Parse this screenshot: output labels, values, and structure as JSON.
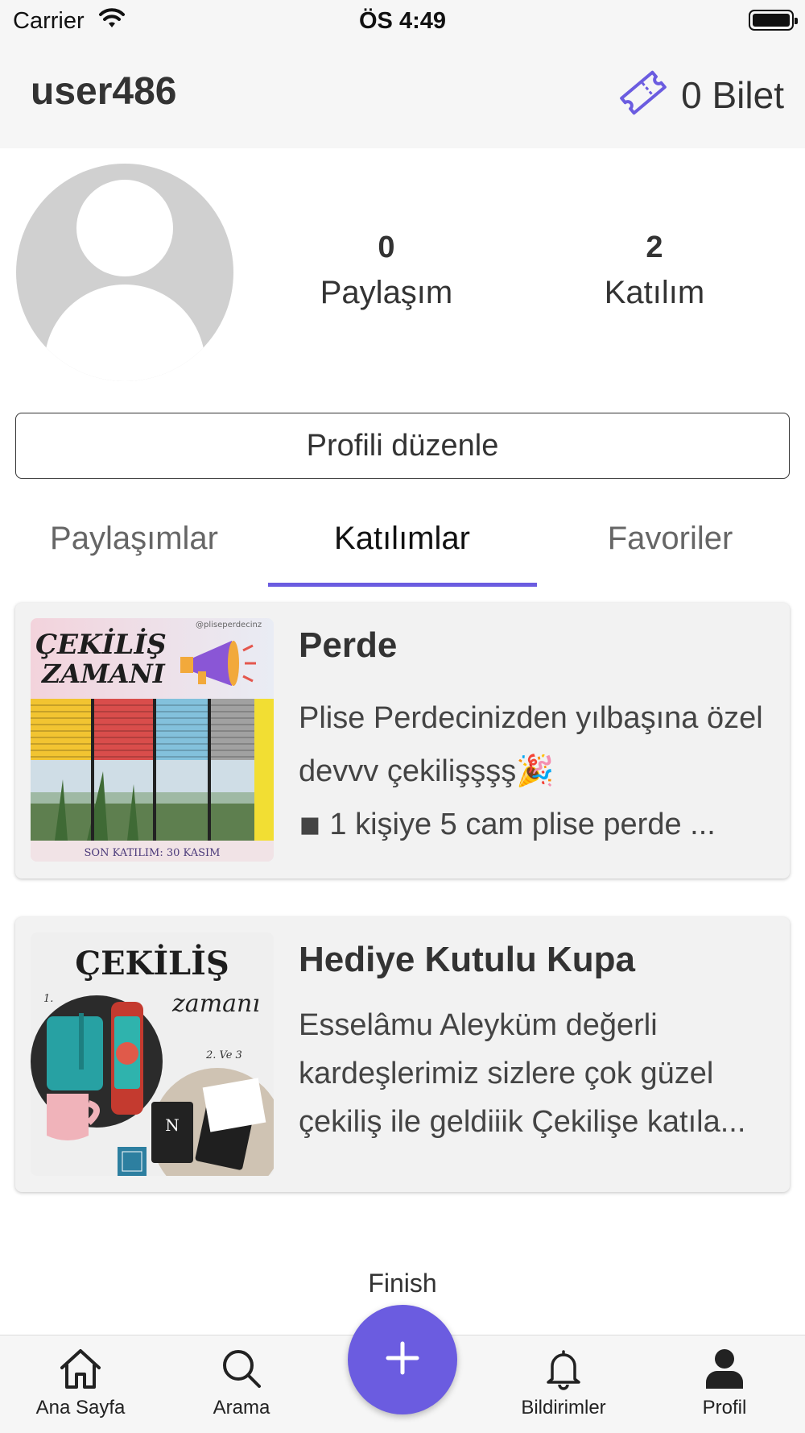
{
  "status_bar": {
    "carrier": "Carrier",
    "time": "ÖS 4:49"
  },
  "header": {
    "username": "user486",
    "ticket_label": "0 Bilet"
  },
  "profile": {
    "stats": [
      {
        "value": "0",
        "label": "Paylaşım"
      },
      {
        "value": "2",
        "label": "Katılım"
      }
    ],
    "edit_button": "Profili düzenle"
  },
  "tabs": [
    {
      "label": "Paylaşımlar",
      "active": false
    },
    {
      "label": "Katılımlar",
      "active": true
    },
    {
      "label": "Favoriler",
      "active": false
    }
  ],
  "cards": [
    {
      "title": "Perde",
      "description_lines": [
        "Plise Perdecinizden yılbaşına özel",
        "devvv çekilişşşş🎉",
        "◾ 1 kişiye 5 cam plise perde ..."
      ],
      "image": {
        "headline_1": "ÇEKİLİŞ",
        "headline_2": "ZAMANI",
        "handle": "@pliseperdecinz",
        "footer": "SON KATILIM: 30 KASIM"
      }
    },
    {
      "title": "Hediye Kutulu Kupa",
      "description_lines": [
        "Esselâmu Aleyküm değerli",
        "kardeşlerimiz sizlere çok güzel",
        "çekiliş ile geldiiik Çekilişe katıla..."
      ],
      "image": {
        "headline_1": "ÇEKİLİŞ",
        "headline_2": "zamanı",
        "marker_1": "1.",
        "marker_2": "2. Ve 3",
        "monogram": "N"
      }
    }
  ],
  "bottom_nav": {
    "finish_label": "Finish",
    "items": [
      {
        "label": "Ana Sayfa",
        "icon": "home-icon"
      },
      {
        "label": "Arama",
        "icon": "search-icon"
      },
      {
        "label": "Bildirimler",
        "icon": "bell-icon"
      },
      {
        "label": "Profil",
        "icon": "person-icon"
      }
    ]
  },
  "colors": {
    "accent": "#6b5ce0",
    "header_bg": "#f6f6f6",
    "avatar_gray": "#d0d0d0",
    "card_bg": "#f2f2f2"
  }
}
